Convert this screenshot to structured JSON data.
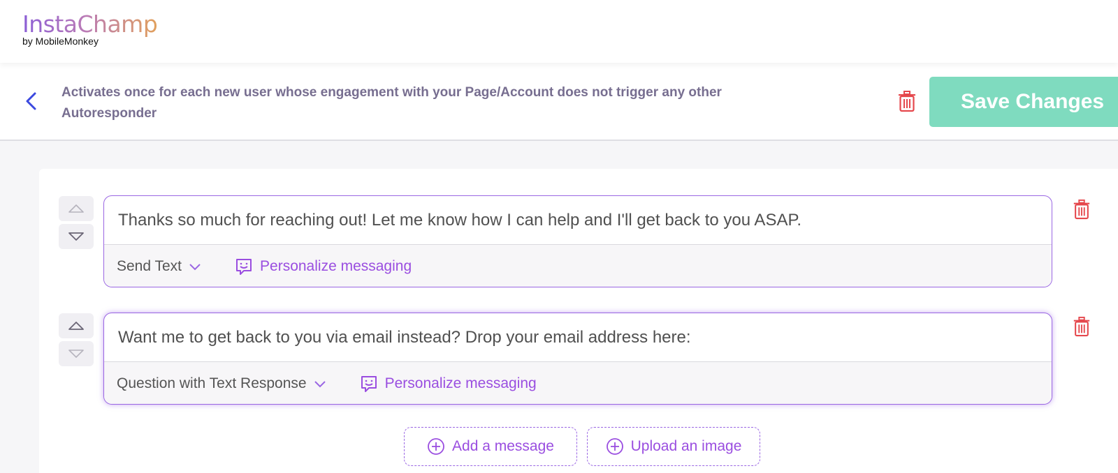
{
  "logo": {
    "name": "InstaChamp",
    "byline": "by MobileMonkey"
  },
  "header": {
    "description": "Activates once for each new user whose engagement with your Page/Account does not trigger any other Autoresponder",
    "save_label": "Save Changes"
  },
  "messages": [
    {
      "text": "Thanks so much for reaching out! Let me know how I can help and I'll get back to you ASAP.",
      "type": "Send Text",
      "personalize": "Personalize messaging"
    },
    {
      "text": "Want me to get back to you via email instead? Drop your email address here:",
      "type": "Question with Text Response",
      "personalize": "Personalize messaging"
    }
  ],
  "actions": {
    "add_message": "Add a message",
    "upload_image": "Upload an image"
  },
  "colors": {
    "accent": "#9a66e3",
    "save": "#7fdbbf",
    "danger": "#e5484d",
    "back": "#3b49df"
  }
}
